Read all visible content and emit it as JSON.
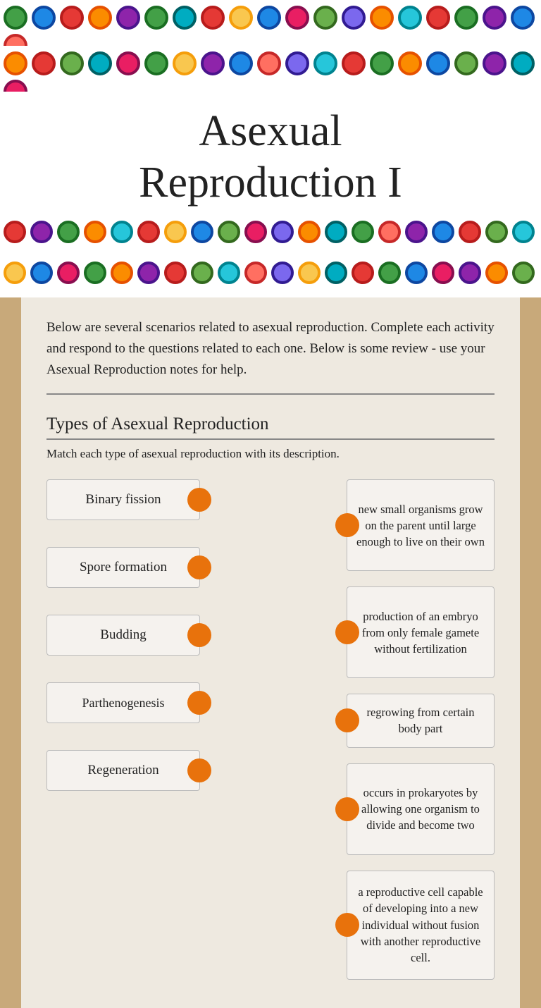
{
  "header": {
    "title": "Asexual\nReproduction I",
    "title_line1": "Asexual",
    "title_line2": "Reproduction I"
  },
  "intro": {
    "text": "Below are several scenarios related to asexual reproduction. Complete each activity and respond to the questions related to each one. Below is some review - use your Asexual Reproduction notes for help."
  },
  "section": {
    "title": "Types of Asexual Reproduction",
    "instruction": "Match each type of asexual reproduction with its description."
  },
  "terms": [
    {
      "id": "binary-fission",
      "label": "Binary fission"
    },
    {
      "id": "spore-formation",
      "label": "Spore formation"
    },
    {
      "id": "budding",
      "label": "Budding"
    },
    {
      "id": "parthenogenesis",
      "label": "Parthenogenesis"
    },
    {
      "id": "regeneration",
      "label": "Regeneration"
    }
  ],
  "descriptions": [
    {
      "id": "desc-budding",
      "text": "new small organisms grow on the parent until large enough to live on their own"
    },
    {
      "id": "desc-parthenogenesis",
      "text": "production of an embryo from only female gamete without fertilization"
    },
    {
      "id": "desc-regeneration",
      "text": "regrowing from certain body part"
    },
    {
      "id": "desc-binary-fission",
      "text": "occurs in prokaryotes by allowing one organism to divide and become two"
    },
    {
      "id": "desc-spore",
      "text": "a reproductive cell capable of developing into a new individual without fusion with another reproductive cell."
    }
  ]
}
